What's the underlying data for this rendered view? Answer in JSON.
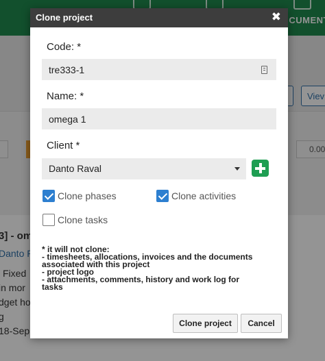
{
  "background": {
    "top_right_label": "CUMENT",
    "view_button": "Viev",
    "amount": "0.00",
    "project_heading": "3] - om",
    "client_link": "Danto R",
    "lines": [
      "Fixed",
      "in mor",
      "dget ho",
      "g",
      "18-Sep"
    ]
  },
  "modal": {
    "title": "Clone project",
    "code_label": "Code: *",
    "code_value": "tre333-1",
    "name_label": "Name: *",
    "name_value": "omega 1",
    "client_label": "Client *",
    "client_value": "Danto Raval",
    "clone_phases_label": "Clone phases",
    "clone_phases_checked": true,
    "clone_activities_label": "Clone activities",
    "clone_activities_checked": true,
    "clone_tasks_label": "Clone tasks",
    "clone_tasks_checked": false,
    "note_lines": [
      "* it will not clone:",
      "- timesheets, allocations, invoices and the documents",
      "associated with this project",
      "- project logo",
      "- attachments, comments, history and work log for",
      "tasks"
    ],
    "clone_button": "Clone project",
    "cancel_button": "Cancel"
  },
  "colors": {
    "header_green": "#1f8a4f",
    "checkbox_blue": "#2d7fd0",
    "add_green": "#1e9e52",
    "modal_header": "#3d3d3d"
  }
}
